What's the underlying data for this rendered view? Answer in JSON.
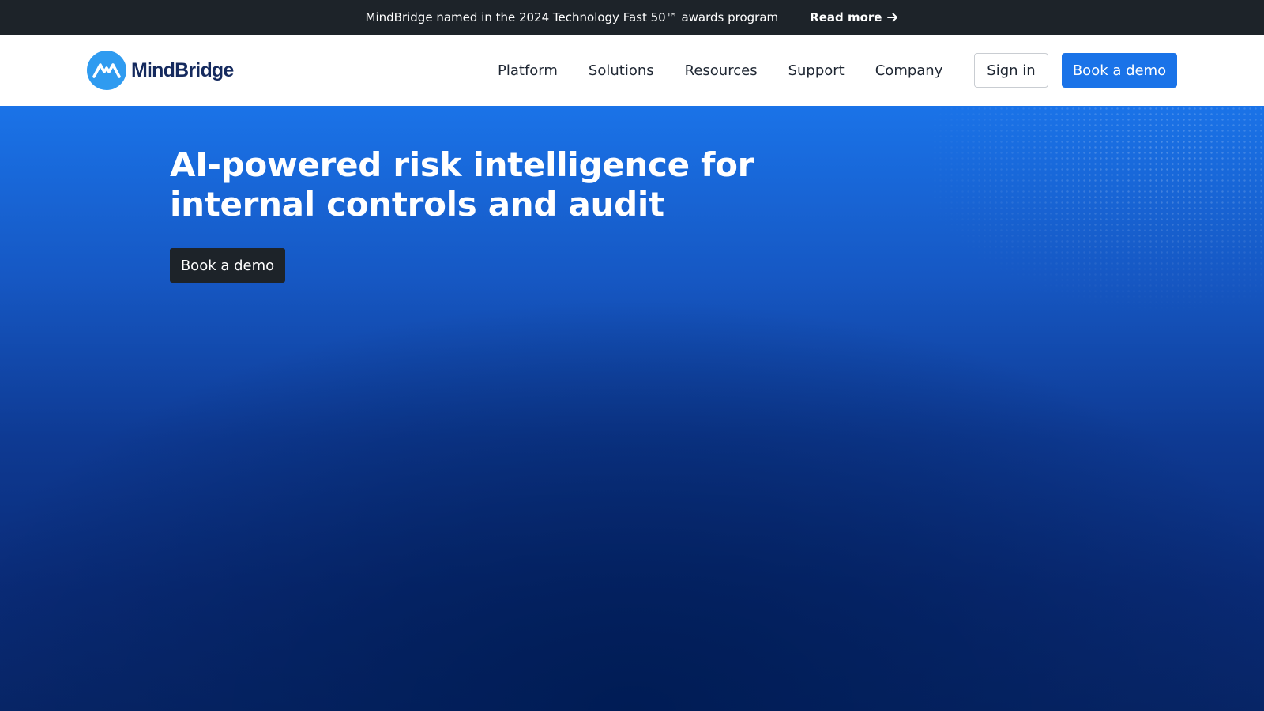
{
  "announcement": {
    "text": "MindBridge named in the 2024 Technology Fast 50™ awards program",
    "link_label": "Read more",
    "link_icon": "arrow-right-icon"
  },
  "nav": {
    "brand": "MindBridge",
    "links": [
      "Platform",
      "Solutions",
      "Resources",
      "Support",
      "Company"
    ],
    "sign_in": "Sign in",
    "book_demo": "Book a demo"
  },
  "hero": {
    "title_line1": "AI-powered risk intelligence for",
    "title_line2": "internal controls and audit",
    "cta": "Book a demo"
  },
  "colors": {
    "announcement_bg": "#1d2329",
    "accent": "#1a73e8",
    "logo_mark": "#2f9bf0",
    "brand_text": "#152a5e",
    "hero_deep": "#001c55"
  }
}
